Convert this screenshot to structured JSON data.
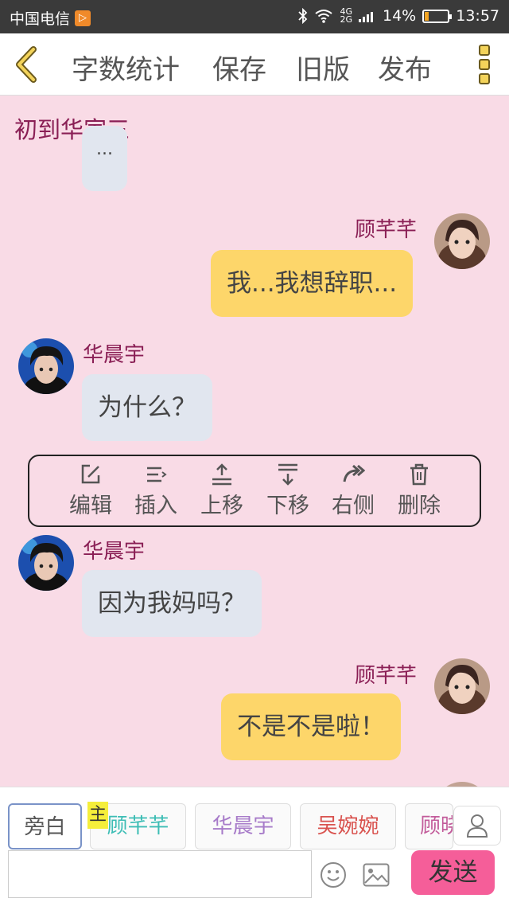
{
  "status_bar": {
    "carrier": "中国电信",
    "network": "4G 2G",
    "battery_percent": "14%",
    "time": "13:57",
    "battery_level": 0.14
  },
  "toolbar": {
    "word_count": "字数统计",
    "save": "保存",
    "old_version": "旧版",
    "publish": "发布"
  },
  "chat": {
    "title": "初到华家三",
    "messages": [
      {
        "speaker": "",
        "text": "...",
        "side": "left",
        "style": "gray"
      },
      {
        "speaker": "顾芊芊",
        "text": "我...我想辞职...",
        "side": "right",
        "style": "yellow"
      },
      {
        "speaker": "华晨宇",
        "text": "为什么？",
        "side": "left",
        "style": "gray"
      },
      {
        "speaker": "华晨宇",
        "text": "因为我妈吗？",
        "side": "left",
        "style": "gray"
      },
      {
        "speaker": "顾芊芊",
        "text": "不是不是啦！",
        "side": "right",
        "style": "yellow"
      }
    ]
  },
  "context_menu": {
    "edit": "编辑",
    "insert": "插入",
    "move_up": "上移",
    "move_down": "下移",
    "right_side": "右侧",
    "delete": "删除"
  },
  "bottom": {
    "roles": [
      {
        "name": "旁白",
        "color": "#555555"
      },
      {
        "name": "顾芊芊",
        "color": "#3dbdb5"
      },
      {
        "name": "华晨宇",
        "color": "#a77bc9"
      },
      {
        "name": "吴婉婉",
        "color": "#d9534f"
      },
      {
        "name": "顾晓",
        "color": "#c25b9a"
      }
    ],
    "main_badge": "主",
    "input_placeholder": "",
    "send": "发送"
  }
}
